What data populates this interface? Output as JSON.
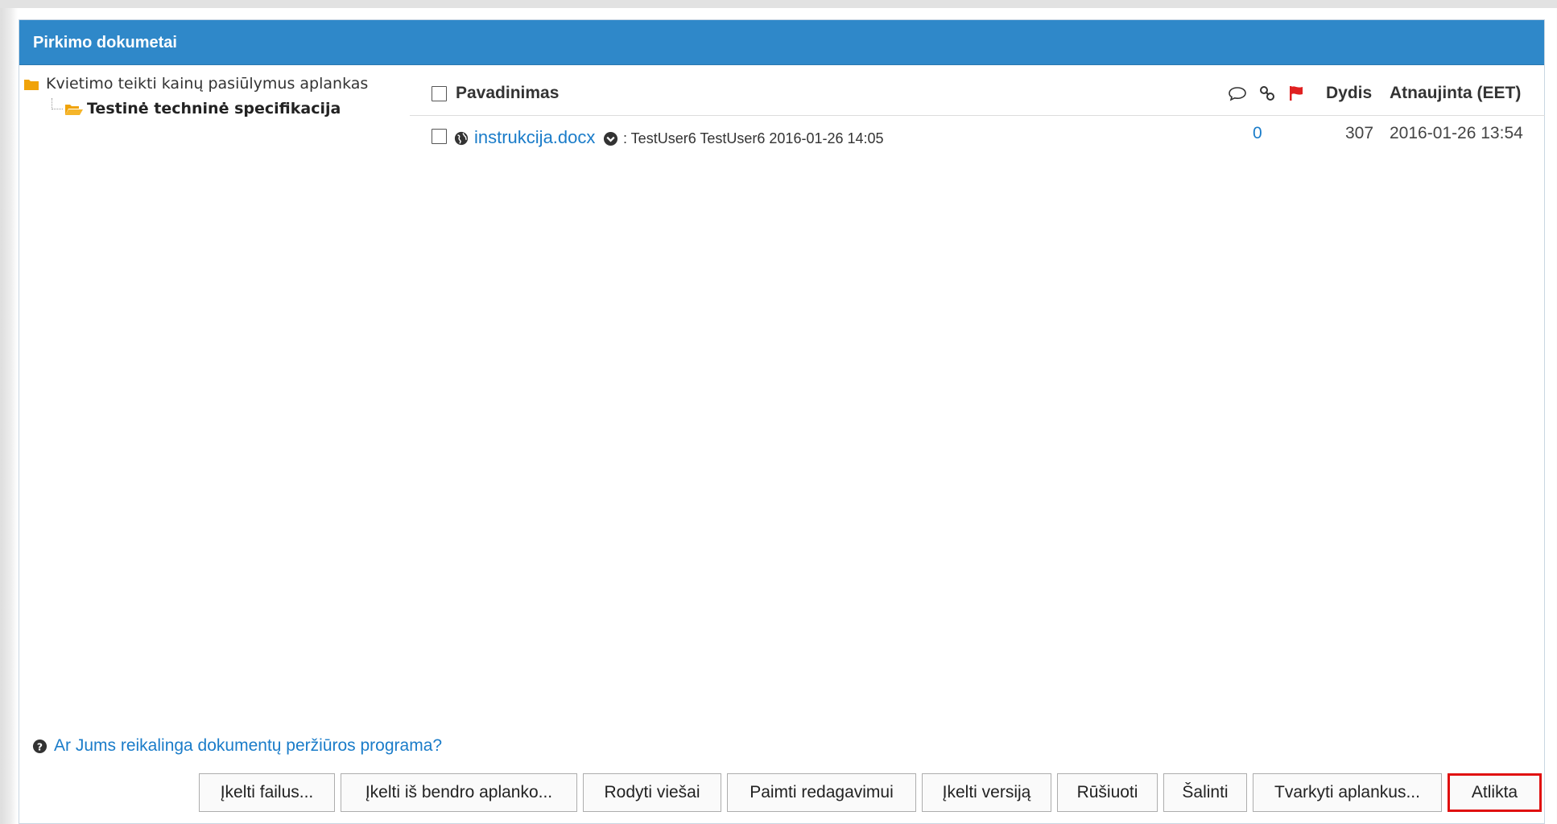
{
  "panel": {
    "title": "Pirkimo dokumetai"
  },
  "tree": {
    "root_label": "Kvietimo teikti kainų pasiūlymus aplankas",
    "child_label": "Testinė techninė specifikacija"
  },
  "table": {
    "headers": {
      "name": "Pavadinimas",
      "size": "Dydis",
      "updated": "Atnaujinta (EET)"
    },
    "header_icons": [
      "comment-icon",
      "link-icon",
      "flag-icon"
    ],
    "rows": [
      {
        "file_name": "instrukcija.docx",
        "meta": ": TestUser6 TestUser6 2016-01-26 14:05",
        "comments": "0",
        "size": "307",
        "updated": "2016-01-26 13:54"
      }
    ]
  },
  "help": {
    "text": "Ar Jums reikalinga dokumentų peržiūros programa?"
  },
  "buttons": {
    "upload": "Įkelti failus...",
    "upload_shared": "Įkelti iš bendro aplanko...",
    "show_public": "Rodyti viešai",
    "take_edit": "Paimti redagavimui",
    "upload_version": "Įkelti versiją",
    "sort": "Rūšiuoti",
    "delete": "Šalinti",
    "manage_folders": "Tvarkyti aplankus...",
    "done": "Atlikta"
  },
  "colors": {
    "header_bg": "#2f88c9",
    "link": "#1a7cc9",
    "flag": "#e02020",
    "folder": "#f0a30a",
    "highlight_border": "#e01010"
  }
}
